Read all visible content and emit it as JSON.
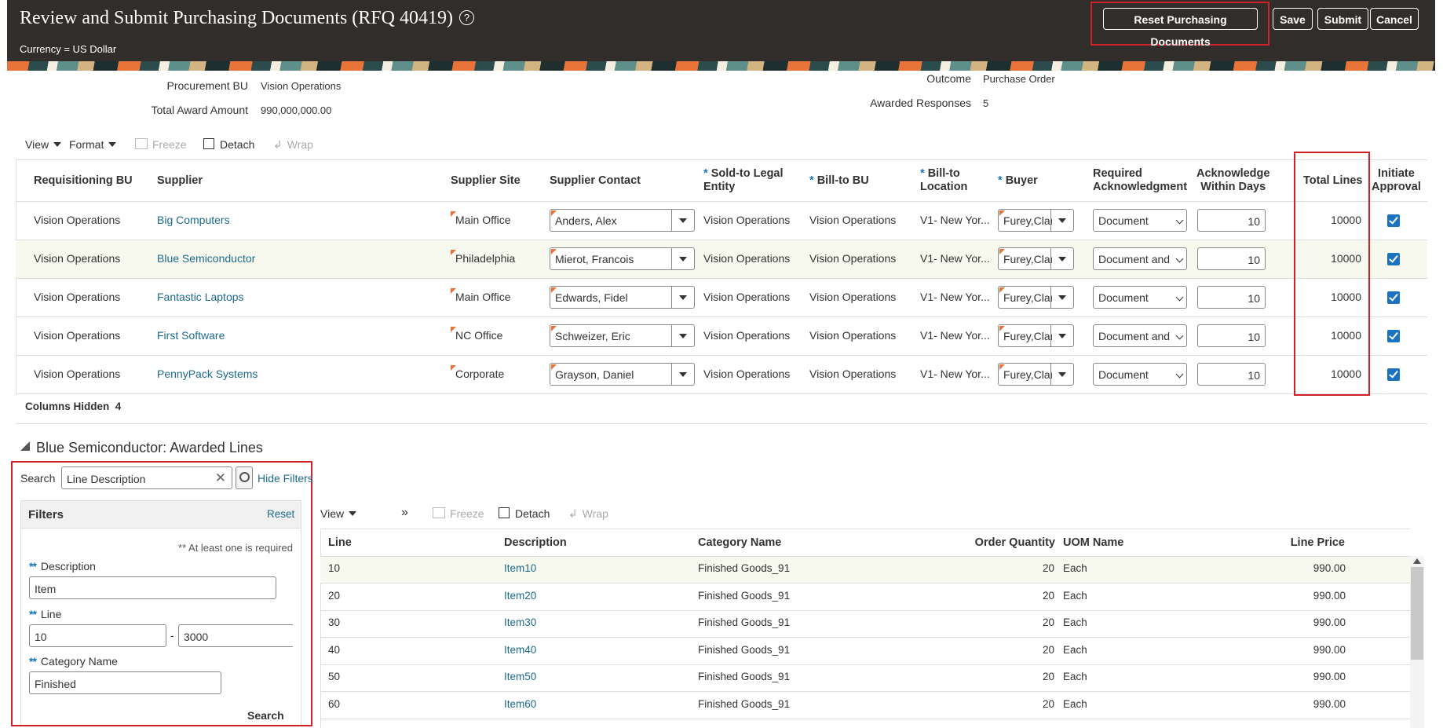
{
  "header": {
    "title": "Review and Submit Purchasing Documents (RFQ 40419)",
    "currency": "Currency = US Dollar",
    "buttons": {
      "reset": "Reset Purchasing Documents",
      "save": "Save",
      "submit": "Submit",
      "cancel": "Cancel"
    }
  },
  "meta": {
    "procurement_bu_label": "Procurement BU",
    "procurement_bu": "Vision Operations",
    "total_award_label": "Total Award Amount",
    "total_award": "990,000,000.00",
    "outcome_label": "Outcome",
    "outcome": "Purchase Order",
    "awarded_label": "Awarded Responses",
    "awarded": "5"
  },
  "toolbar": {
    "view": "View",
    "format": "Format",
    "freeze": "Freeze",
    "detach": "Detach",
    "wrap": "Wrap"
  },
  "docs_table": {
    "headers": {
      "req_bu": "Requisitioning BU",
      "supplier": "Supplier",
      "site": "Supplier Site",
      "contact": "Supplier Contact",
      "sold_to_1": "Sold-to Legal",
      "sold_to_2": "Entity",
      "bill_bu": "Bill-to BU",
      "bill_loc_1": "Bill-to",
      "bill_loc_2": "Location",
      "buyer": "Buyer",
      "req_ack_1": "Required",
      "req_ack_2": "Acknowledgment",
      "ack_days_1": "Acknowledge",
      "ack_days_2": "Within Days",
      "total_lines": "Total Lines",
      "init_1": "Initiate",
      "init_2": "Approval",
      "star": "*"
    },
    "rows": [
      {
        "req_bu": "Vision Operations",
        "supplier": "Big Computers",
        "site": "Main Office",
        "contact": "Anders, Alex",
        "sold_to": "Vision Operations",
        "bill_bu": "Vision Operations",
        "bill_loc": "V1- New Yor...",
        "buyer": "Furey,Clare",
        "ack": "Document",
        "days": "10",
        "total": "10000"
      },
      {
        "req_bu": "Vision Operations",
        "supplier": "Blue Semiconductor",
        "site": "Philadelphia",
        "contact": "Mierot, Francois",
        "sold_to": "Vision Operations",
        "bill_bu": "Vision Operations",
        "bill_loc": "V1- New Yor...",
        "buyer": "Furey,Clare",
        "ack": "Document and S",
        "days": "10",
        "total": "10000"
      },
      {
        "req_bu": "Vision Operations",
        "supplier": "Fantastic Laptops",
        "site": "Main Office",
        "contact": "Edwards, Fidel",
        "sold_to": "Vision Operations",
        "bill_bu": "Vision Operations",
        "bill_loc": "V1- New Yor...",
        "buyer": "Furey,Clare",
        "ack": "Document",
        "days": "10",
        "total": "10000"
      },
      {
        "req_bu": "Vision Operations",
        "supplier": "First Software",
        "site": "NC Office",
        "contact": "Schweizer, Eric",
        "sold_to": "Vision Operations",
        "bill_bu": "Vision Operations",
        "bill_loc": "V1- New Yor...",
        "buyer": "Furey,Clare",
        "ack": "Document and S",
        "days": "10",
        "total": "10000"
      },
      {
        "req_bu": "Vision Operations",
        "supplier": "PennyPack Systems",
        "site": "Corporate",
        "contact": "Grayson, Daniel",
        "sold_to": "Vision Operations",
        "bill_bu": "Vision Operations",
        "bill_loc": "V1- New Yor...",
        "buyer": "Furey,Clare",
        "ack": "Document",
        "days": "10",
        "total": "10000"
      }
    ],
    "columns_hidden_label": "Columns Hidden",
    "columns_hidden": "4"
  },
  "awarded": {
    "title": "Blue Semiconductor: Awarded Lines",
    "search_label": "Search",
    "search_value": "Line Description",
    "hide_filters": "Hide Filters",
    "filters_title": "Filters",
    "reset": "Reset",
    "required_note": "** At least one is required",
    "desc_label": "Description",
    "desc_value": "Item",
    "line_label": "Line",
    "line_from": "10",
    "line_to": "3000",
    "dash": "-",
    "cat_label": "Category Name",
    "cat_value": "Finished",
    "search_button": "Search",
    "dstar": "**"
  },
  "lines_toolbar": {
    "view": "View",
    "freeze": "Freeze",
    "detach": "Detach",
    "wrap": "Wrap"
  },
  "lines_table": {
    "headers": {
      "line": "Line",
      "desc": "Description",
      "cat": "Category Name",
      "qty": "Order Quantity",
      "uom": "UOM Name",
      "price": "Line Price"
    },
    "rows": [
      {
        "line": "10",
        "desc": "Item10",
        "cat": "Finished Goods_91",
        "qty": "20",
        "uom": "Each",
        "price": "990.00"
      },
      {
        "line": "20",
        "desc": "Item20",
        "cat": "Finished Goods_91",
        "qty": "20",
        "uom": "Each",
        "price": "990.00"
      },
      {
        "line": "30",
        "desc": "Item30",
        "cat": "Finished Goods_91",
        "qty": "20",
        "uom": "Each",
        "price": "990.00"
      },
      {
        "line": "40",
        "desc": "Item40",
        "cat": "Finished Goods_91",
        "qty": "20",
        "uom": "Each",
        "price": "990.00"
      },
      {
        "line": "50",
        "desc": "Item50",
        "cat": "Finished Goods_91",
        "qty": "20",
        "uom": "Each",
        "price": "990.00"
      },
      {
        "line": "60",
        "desc": "Item60",
        "cat": "Finished Goods_91",
        "qty": "20",
        "uom": "Each",
        "price": "990.00"
      }
    ]
  },
  "colors": {
    "header_bg": "#312d2a",
    "highlight": "#d0212a",
    "link": "#1c6a8c",
    "checkbox": "#1a73c1"
  }
}
